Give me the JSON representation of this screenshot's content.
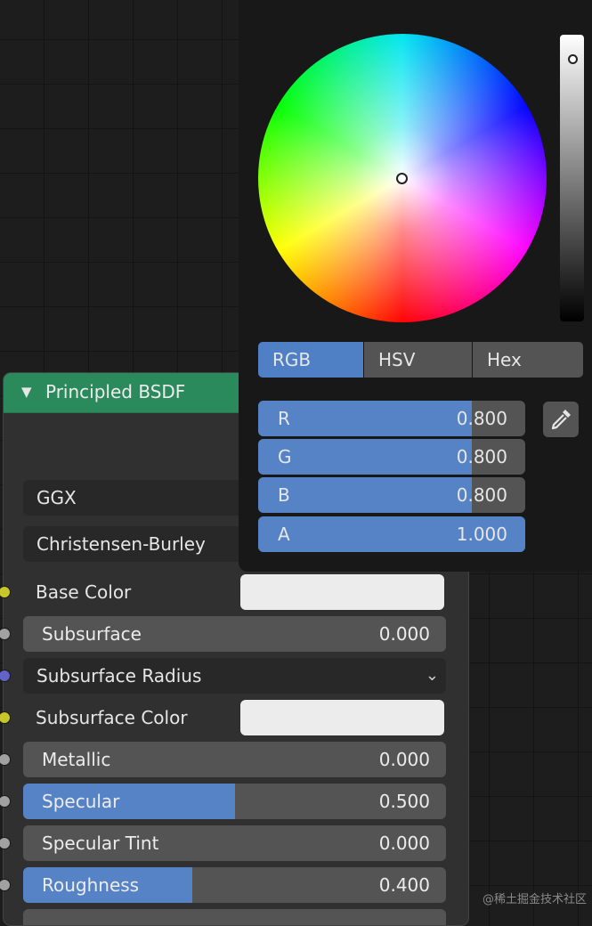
{
  "node": {
    "title": "Principled BSDF",
    "distribution": "GGX",
    "subsurface_method": "Christensen-Burley",
    "base_color_label": "Base Color",
    "subsurface": {
      "label": "Subsurface",
      "value": "0.000",
      "fill": 0.0
    },
    "subsurface_radius_label": "Subsurface Radius",
    "subsurface_color_label": "Subsurface Color",
    "metallic": {
      "label": "Metallic",
      "value": "0.000",
      "fill": 0.0
    },
    "specular": {
      "label": "Specular",
      "value": "0.500",
      "fill": 0.5
    },
    "specular_tint": {
      "label": "Specular Tint",
      "value": "0.000",
      "fill": 0.0
    },
    "roughness": {
      "label": "Roughness",
      "value": "0.400",
      "fill": 0.4
    }
  },
  "color_picker": {
    "tabs": [
      "RGB",
      "HSV",
      "Hex"
    ],
    "active_tab": "RGB",
    "channels": [
      {
        "label": "R",
        "value": "0.800",
        "fill": 0.8
      },
      {
        "label": "G",
        "value": "0.800",
        "fill": 0.8
      },
      {
        "label": "B",
        "value": "0.800",
        "fill": 0.8
      },
      {
        "label": "A",
        "value": "1.000",
        "fill": 1.0
      }
    ],
    "eyedropper_icon": "eyedropper-icon"
  },
  "colors": {
    "node_header": "#2b8a5c",
    "slider_fill": "#5683c6",
    "socket_color": "#c7c729",
    "socket_float": "#a1a1a1",
    "socket_vector": "#6363c7"
  },
  "watermark": "@稀土掘金技术社区"
}
